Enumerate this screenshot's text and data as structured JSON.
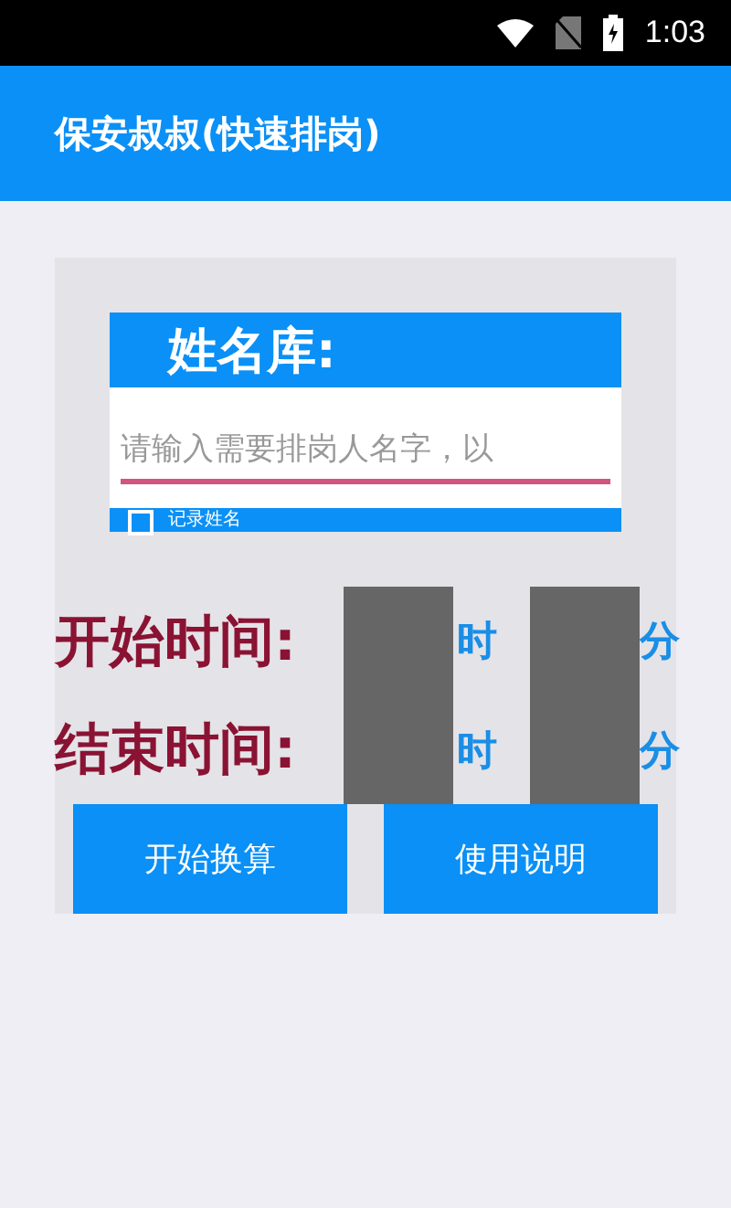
{
  "status_bar": {
    "time": "1:03"
  },
  "app_bar": {
    "title": "保安叔叔(快速排岗)"
  },
  "name_library": {
    "title": "姓名库:",
    "input": {
      "placeholder": "请输入需要排岗人名字，以"
    },
    "remember": {
      "label": "记录姓名",
      "checked": false
    }
  },
  "times": [
    {
      "label": "开始时间:",
      "hour_unit": "时",
      "minute_unit": "分"
    },
    {
      "label": "结束时间:",
      "hour_unit": "时",
      "minute_unit": "分"
    }
  ],
  "buttons": [
    "开始换算",
    "使用说明"
  ]
}
